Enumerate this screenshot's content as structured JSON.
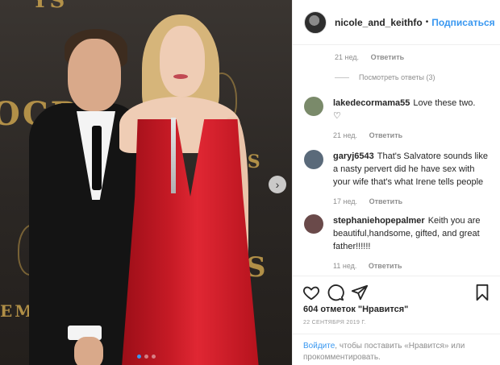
{
  "post": {
    "username": "nicole_and_keithfo",
    "separator": "•",
    "follow_label": "Подписаться"
  },
  "photo": {
    "bg_texts": [
      "YS",
      "OCB",
      "YS",
      "S",
      "EMM"
    ],
    "next_icon": "chevron-right-icon",
    "carousel_count": 3,
    "carousel_active": 1
  },
  "comments": {
    "first_meta": {
      "time": "21 нед.",
      "reply": "Ответить"
    },
    "view_replies": "Посмотреть ответы (3)",
    "items": [
      {
        "user": "lakedecormama55",
        "text": "Love these two.",
        "time": "21 нед.",
        "reply": "Ответить",
        "avatar_color": "#7a8a6a"
      },
      {
        "user": "garyj6543",
        "text": "That's Salvatore sounds like a nasty pervert did he have sex with your wife that's what Irene tells people",
        "time": "17 нед.",
        "reply": "Ответить",
        "avatar_color": "#5a6a7a"
      },
      {
        "user": "stephaniehopepalmer",
        "text": "Keith you are beautiful,handsome, gifted, and great father!!!!!!",
        "time": "11 нед.",
        "reply": "Ответить",
        "avatar_color": "#6a4a4a"
      }
    ]
  },
  "actions": {
    "icons": [
      "heart-icon",
      "comment-icon",
      "share-icon",
      "bookmark-icon"
    ]
  },
  "likes_text": "604 отметок \"Нравится\"",
  "date_text": "22 СЕНТЯБРЯ 2019 Г.",
  "login": {
    "link": "Войдите",
    "text": ", чтобы поставить «Нравится» или прокомментировать."
  }
}
